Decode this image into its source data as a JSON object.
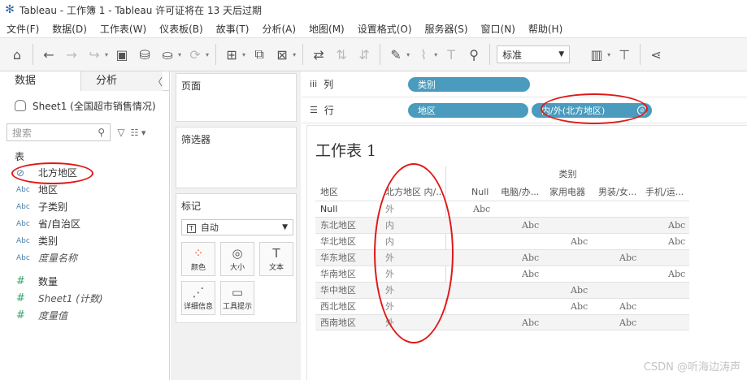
{
  "window": {
    "title": "Tableau - 工作簿 1 - Tableau 许可证将在 13 天后过期"
  },
  "menu": [
    "文件(F)",
    "数据(D)",
    "工作表(W)",
    "仪表板(B)",
    "故事(T)",
    "分析(A)",
    "地图(M)",
    "设置格式(O)",
    "服务器(S)",
    "窗口(N)",
    "帮助(H)"
  ],
  "toolbar": {
    "view_select": "标准"
  },
  "data_pane": {
    "tab_data": "数据",
    "tab_analysis": "分析",
    "datasource": "Sheet1 (全国超市销售情况)",
    "search_placeholder": "搜索",
    "tables_header": "表",
    "dimensions": [
      {
        "type": "geo",
        "name": "北方地区"
      },
      {
        "type": "Abc",
        "name": "地区"
      },
      {
        "type": "Abc",
        "name": "子类别"
      },
      {
        "type": "Abc",
        "name": "省/自治区"
      },
      {
        "type": "Abc",
        "name": "类别"
      },
      {
        "type": "Abc",
        "name": "度量名称"
      }
    ],
    "measures": [
      {
        "type": "#",
        "name": "数量"
      },
      {
        "type": "#",
        "name": "Sheet1 (计数)"
      },
      {
        "type": "#",
        "name": "度量值"
      }
    ]
  },
  "cards": {
    "pages": "页面",
    "filters": "筛选器",
    "marks": "标记",
    "marks_type": "自动",
    "buttons": [
      "颜色",
      "大小",
      "文本",
      "详细信息",
      "工具提示"
    ]
  },
  "shelves": {
    "columns_label": "列",
    "rows_label": "行",
    "column_pills": [
      "类别"
    ],
    "row_pills": [
      "地区",
      "内/外(北方地区)"
    ]
  },
  "worksheet": {
    "title": "工作表 1",
    "top_header": "类别",
    "col_headers": [
      "地区",
      "北方地区 内/...",
      "Null",
      "电脑/办...",
      "家用电器",
      "男装/女...",
      "手机/运..."
    ],
    "rows": [
      {
        "region": "Null",
        "inout": "外",
        "cells": [
          "Abc",
          "",
          "",
          "",
          ""
        ]
      },
      {
        "region": "东北地区",
        "inout": "内",
        "cells": [
          "",
          "Abc",
          "",
          "",
          "Abc"
        ]
      },
      {
        "region": "华北地区",
        "inout": "内",
        "cells": [
          "",
          "",
          "Abc",
          "",
          "Abc"
        ]
      },
      {
        "region": "华东地区",
        "inout": "外",
        "cells": [
          "",
          "Abc",
          "",
          "Abc",
          ""
        ]
      },
      {
        "region": "华南地区",
        "inout": "外",
        "cells": [
          "",
          "Abc",
          "",
          "",
          "Abc"
        ]
      },
      {
        "region": "华中地区",
        "inout": "外",
        "cells": [
          "",
          "",
          "Abc",
          "",
          ""
        ]
      },
      {
        "region": "西北地区",
        "inout": "外",
        "cells": [
          "",
          "",
          "Abc",
          "Abc",
          ""
        ]
      },
      {
        "region": "西南地区",
        "inout": "外",
        "cells": [
          "",
          "Abc",
          "",
          "Abc",
          ""
        ]
      }
    ]
  },
  "watermark": "CSDN @听海边涛声",
  "colors": {
    "pill": "#4a9bbd",
    "annotation": "#e01818"
  }
}
